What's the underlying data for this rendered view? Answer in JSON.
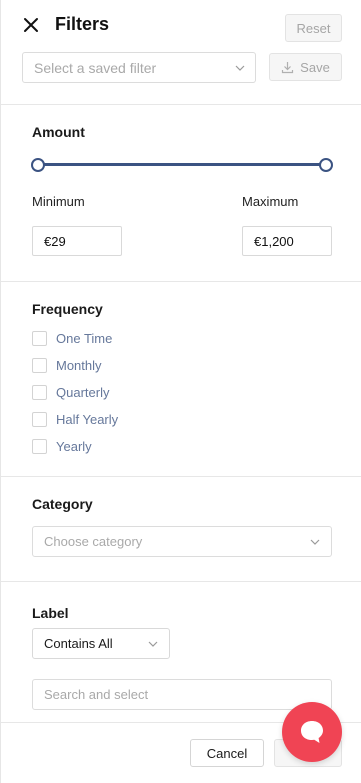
{
  "header": {
    "title": "Filters",
    "reset_label": "Reset",
    "saved_filter_placeholder": "Select a saved filter",
    "save_label": "Save"
  },
  "amount": {
    "title": "Amount",
    "minimum_label": "Minimum",
    "maximum_label": "Maximum",
    "minimum_value": "€29",
    "maximum_value": "€1,200",
    "slider_range_fraction": [
      0,
      1
    ]
  },
  "frequency": {
    "title": "Frequency",
    "options": [
      {
        "label": "One Time",
        "checked": false
      },
      {
        "label": "Monthly",
        "checked": false
      },
      {
        "label": "Quarterly",
        "checked": false
      },
      {
        "label": "Half Yearly",
        "checked": false
      },
      {
        "label": "Yearly",
        "checked": false
      }
    ]
  },
  "category": {
    "title": "Category",
    "placeholder": "Choose category"
  },
  "label": {
    "title": "Label",
    "match_mode": "Contains All",
    "search_placeholder": "Search and select"
  },
  "footer": {
    "cancel_label": "Cancel"
  },
  "colors": {
    "slider": "#3b5382",
    "checkbox_label": "#66789b",
    "chat_button": "#f04454"
  },
  "icons": [
    "close-icon",
    "chevron-down-icon",
    "download-icon",
    "chat-bubble-icon"
  ]
}
